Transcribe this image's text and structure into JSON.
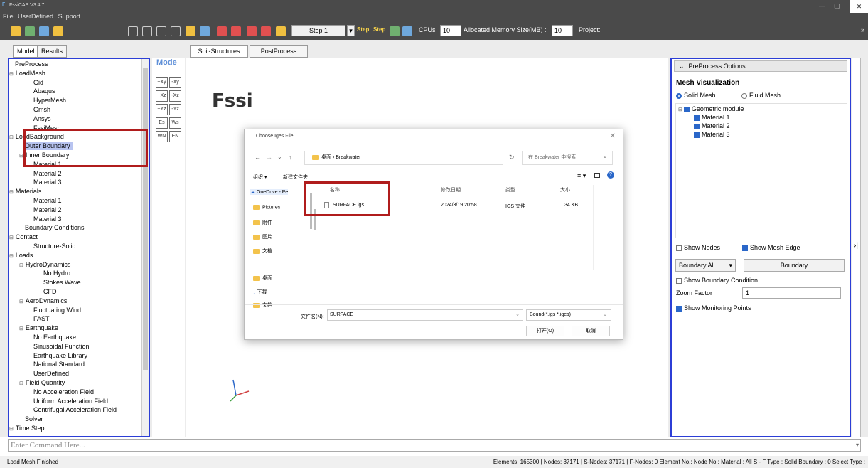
{
  "app": {
    "title": "FssiCAS V3.4.7"
  },
  "menu": [
    "File",
    "UserDefined",
    "Support"
  ],
  "toolbar": {
    "step_select": "Step 1",
    "step_buttons": [
      "Step",
      "Step",
      "Step"
    ],
    "cpus_label": "CPUs",
    "cpus_value": "10",
    "memory_label": "Allocated Memory Size(MB) :",
    "memory_value": "10",
    "project_label": "Project:"
  },
  "left_tabs": [
    "Model",
    "Results"
  ],
  "main_tabs": [
    "Soil-Structures",
    "PostProcess"
  ],
  "tree": [
    {
      "label": "PreProcess",
      "level": 0,
      "toggle": ""
    },
    {
      "label": "LoadMesh",
      "level": 0,
      "toggle": "⊟"
    },
    {
      "label": "Gid",
      "level": 2,
      "toggle": ""
    },
    {
      "label": "Abaqus",
      "level": 2,
      "toggle": ""
    },
    {
      "label": "HyperMesh",
      "level": 2,
      "toggle": ""
    },
    {
      "label": "Gmsh",
      "level": 2,
      "toggle": ""
    },
    {
      "label": "Ansys",
      "level": 2,
      "toggle": ""
    },
    {
      "label": "FssiMesh",
      "level": 2,
      "toggle": ""
    },
    {
      "label": "LoadBackground",
      "level": 0,
      "toggle": "⊟"
    },
    {
      "label": "Outer Boundary",
      "level": 1,
      "toggle": "",
      "selected": true
    },
    {
      "label": "Inner Boundary",
      "level": 1,
      "toggle": "⊟"
    },
    {
      "label": "Material 1",
      "level": 2,
      "toggle": ""
    },
    {
      "label": "Material 2",
      "level": 2,
      "toggle": ""
    },
    {
      "label": "Material 3",
      "level": 2,
      "toggle": ""
    },
    {
      "label": "Materials",
      "level": 0,
      "toggle": "⊟"
    },
    {
      "label": "Material 1",
      "level": 2,
      "toggle": ""
    },
    {
      "label": "Material 2",
      "level": 2,
      "toggle": ""
    },
    {
      "label": "Material 3",
      "level": 2,
      "toggle": ""
    },
    {
      "label": "Boundary Conditions",
      "level": 1,
      "toggle": ""
    },
    {
      "label": "Contact",
      "level": 0,
      "toggle": "⊟"
    },
    {
      "label": "Structure-Solid",
      "level": 2,
      "toggle": ""
    },
    {
      "label": "Loads",
      "level": 0,
      "toggle": "⊟"
    },
    {
      "label": "HydroDynamics",
      "level": 1,
      "toggle": "⊟"
    },
    {
      "label": "No Hydro",
      "level": 3,
      "toggle": ""
    },
    {
      "label": "Stokes Wave",
      "level": 3,
      "toggle": ""
    },
    {
      "label": "CFD",
      "level": 3,
      "toggle": ""
    },
    {
      "label": "AeroDynamics",
      "level": 1,
      "toggle": "⊟"
    },
    {
      "label": "Fluctuating Wind",
      "level": 2,
      "toggle": ""
    },
    {
      "label": "FAST",
      "level": 2,
      "toggle": ""
    },
    {
      "label": "Earthquake",
      "level": 1,
      "toggle": "⊟"
    },
    {
      "label": "No Earthquake",
      "level": 2,
      "toggle": ""
    },
    {
      "label": "Sinusoidal Function",
      "level": 2,
      "toggle": ""
    },
    {
      "label": "Earthquake Library",
      "level": 2,
      "toggle": ""
    },
    {
      "label": "National Standard",
      "level": 2,
      "toggle": ""
    },
    {
      "label": "UserDefined",
      "level": 2,
      "toggle": ""
    },
    {
      "label": "Field Quantity",
      "level": 1,
      "toggle": "⊟"
    },
    {
      "label": "No Acceleration Field",
      "level": 2,
      "toggle": ""
    },
    {
      "label": "Uniform Acceleration Field",
      "level": 2,
      "toggle": ""
    },
    {
      "label": "Centrifugal Acceleration Field",
      "level": 2,
      "toggle": ""
    },
    {
      "label": "Solver",
      "level": 1,
      "toggle": ""
    },
    {
      "label": "Time Step",
      "level": 0,
      "toggle": "⊟"
    }
  ],
  "side_tools": {
    "mode_label": "Mode",
    "buttons": [
      "+Xy",
      "-Xy",
      "+Xz",
      "-Xz",
      "+Yz",
      "-Yz",
      "Es",
      "Ws",
      "WN",
      "EN"
    ]
  },
  "canvas": {
    "logo": "Fssi"
  },
  "dialog": {
    "title": "Choose Iges File...",
    "address": "桌面 › Breakwater",
    "search_placeholder": "在 Breakwater 中搜索",
    "organize": "组织 ▾",
    "new_folder": "新建文件夹",
    "nav": [
      "OneDrive - Pe",
      "Pictures",
      "附件",
      "图片",
      "文档",
      "桌面",
      "下载",
      "文档"
    ],
    "columns": [
      "名称",
      "修改日期",
      "类型",
      "大小"
    ],
    "file": {
      "name": "SURFACE.igs",
      "date": "2024/3/19 20:58",
      "type": "IGS 文件",
      "size": "34 KB"
    },
    "filename_label": "文件名(N):",
    "filename_value": "SURFACE",
    "filter": "Bound(*.igs *.iges)",
    "open": "打开(O)",
    "cancel": "取消"
  },
  "right_panel": {
    "header": "PreProcess Options",
    "section": "Mesh Visualization",
    "solid_mesh": "Solid Mesh",
    "fluid_mesh": "Fluid Mesh",
    "geo_module": "Geometric module",
    "materials": [
      "Material 1",
      "Material 2",
      "Material 3"
    ],
    "show_nodes": "Show Nodes",
    "show_mesh_edge": "Show Mesh Edge",
    "boundary_all": "Boundary All",
    "boundary": "Boundary",
    "show_boundary_condition": "Show Boundary Condition",
    "zoom_label": "Zoom Factor",
    "zoom_value": "1",
    "show_monitoring": "Show Monitoring Points"
  },
  "command": {
    "placeholder": "Enter Command Here..."
  },
  "status": {
    "left": "Load Mesh Finished",
    "right": "Elements: 165300 | Nodes: 37171 | S-Nodes: 37171 | F-Nodes: 0 Element No.:  Node No.:  Material :  All   S - F Type :  Solid   Boundary :  0   Select Type :"
  },
  "colors": {
    "panel_border": "#2c3ed6",
    "highlight": "#b01c1c",
    "titlebar": "#4a4a4a"
  }
}
